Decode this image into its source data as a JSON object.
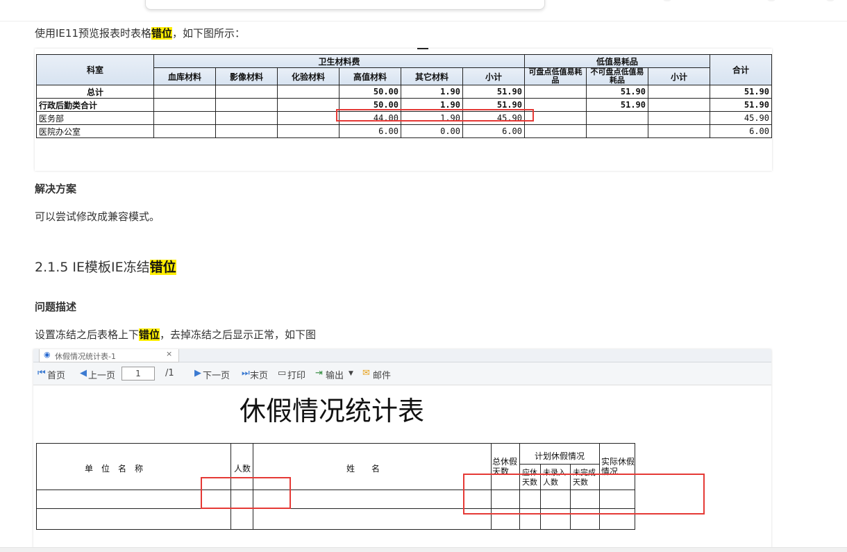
{
  "intro_text_prefix": "使用IE11预览报表时表格",
  "highlight": "错位",
  "intro_text_suffix": "，如下图所示：",
  "solution_heading": "解决方案",
  "solution_text": "可以尝试修改成兼容模式。",
  "section_heading_prefix": "2.1.5 IE模板IE冻结",
  "problem_heading": "问题描述",
  "problem_text_prefix": "设置冻结之后表格上下",
  "problem_text_suffix": "，去掉冻结之后显示正常，如下图",
  "table1": {
    "col_dept": "科室",
    "group_health": "卫生材料费",
    "group_low": "低值易耗品",
    "col_total": "合计",
    "sub_cols": [
      "血库材料",
      "影像材料",
      "化验材料",
      "高值材料",
      "其它材料",
      "小计"
    ],
    "low_cols": [
      "可盘点低值易耗品",
      "不可盘点低值易耗品",
      "小计"
    ],
    "rows": [
      {
        "name": "总计",
        "v": [
          "",
          "",
          "",
          "50.00",
          "1.90",
          "51.90",
          "",
          "51.90",
          "",
          "51.90"
        ]
      },
      {
        "name": "行政后勤类合计",
        "v": [
          "",
          "",
          "",
          "50.00",
          "1.90",
          "51.90",
          "",
          "51.90",
          "",
          "51.90"
        ]
      },
      {
        "name": "医务部",
        "v": [
          "",
          "",
          "",
          "44.00",
          "1.90",
          "45.90",
          "",
          "",
          "",
          "45.90"
        ]
      },
      {
        "name": "医院办公室",
        "v": [
          "",
          "",
          "",
          "6.00",
          "0.00",
          "6.00",
          "",
          "",
          "",
          "6.00"
        ]
      }
    ]
  },
  "viewer": {
    "tab_label": "休假情况统计表-1",
    "first": "首页",
    "prev": "上一页",
    "page": "1",
    "page_total": "/1",
    "next": "下一页",
    "last": "末页",
    "print": "打印",
    "export": "输出",
    "mail": "邮件",
    "title": "休假情况统计表",
    "h_unit": "单　位　名　称",
    "h_count": "人数",
    "h_name": "姓　　名",
    "h_total": "总休假天数",
    "h_plan": "计划休假情况",
    "h_actual": "实际休假情况",
    "h_should": "应休天数",
    "h_unrecorded": "未录入人数",
    "h_undone": "未完成天数"
  }
}
